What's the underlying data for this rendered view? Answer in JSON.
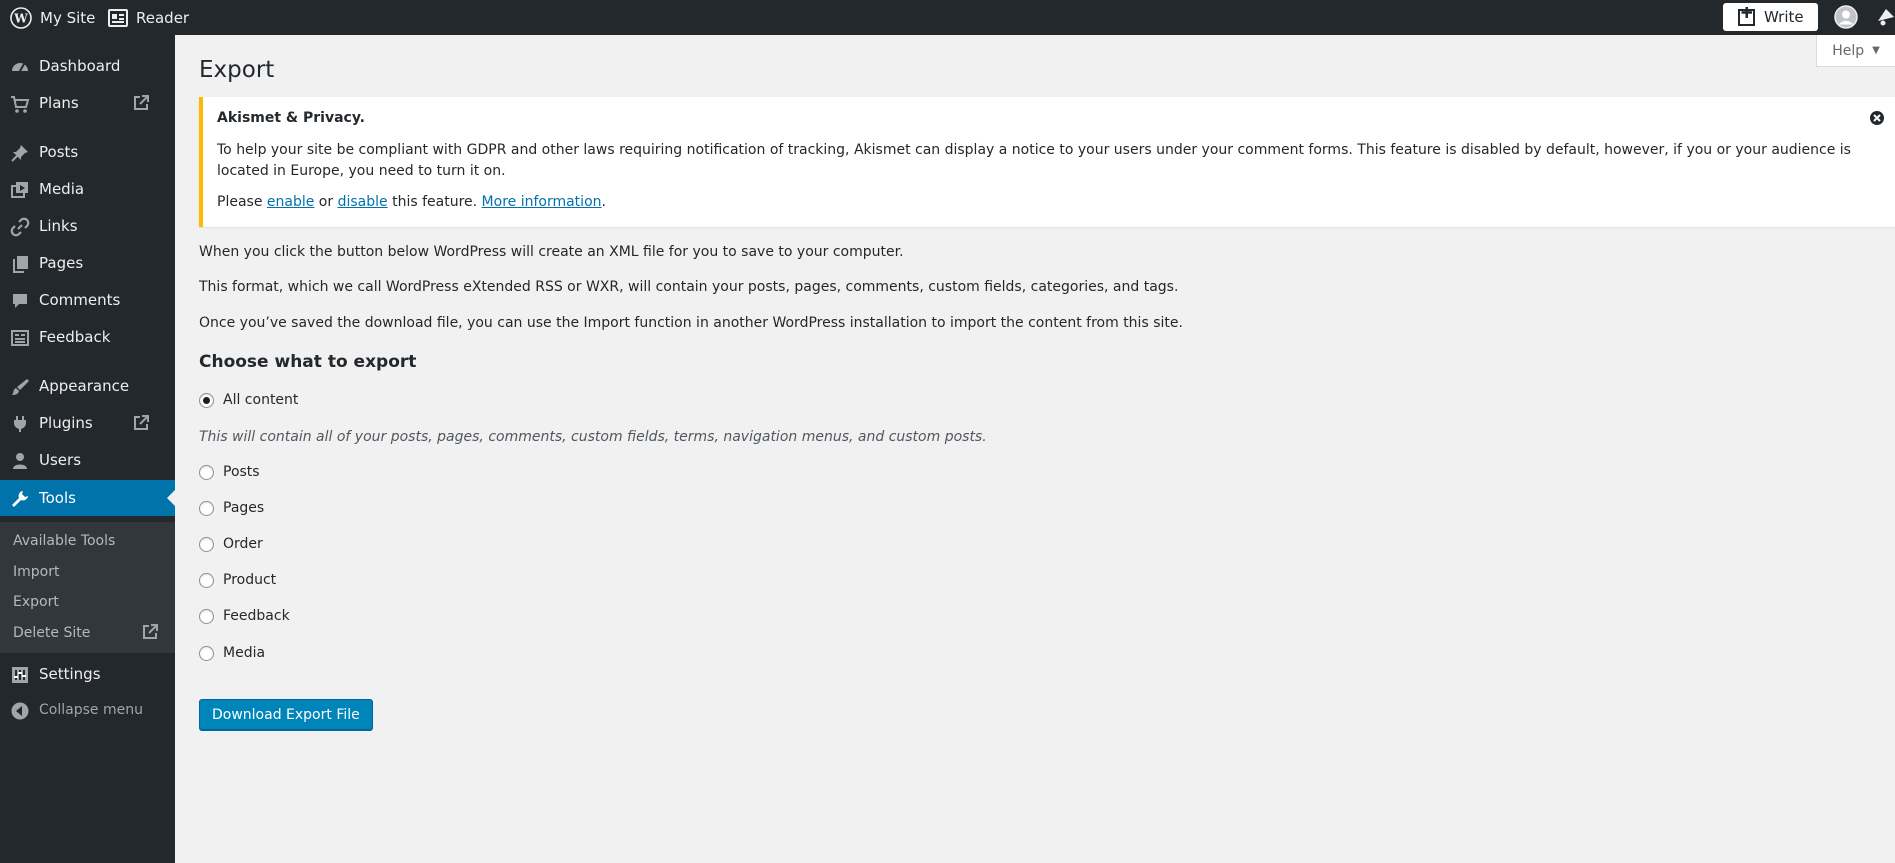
{
  "topbar": {
    "my_site": "My Site",
    "reader": "Reader",
    "write": "Write"
  },
  "sidebar": {
    "items": [
      {
        "label": "Dashboard",
        "icon": "dashboard-icon"
      },
      {
        "label": "Plans",
        "icon": "cart-icon",
        "external": true
      },
      {
        "label": "Posts",
        "icon": "pin-icon"
      },
      {
        "label": "Media",
        "icon": "media-icon"
      },
      {
        "label": "Links",
        "icon": "link-icon"
      },
      {
        "label": "Pages",
        "icon": "pages-icon"
      },
      {
        "label": "Comments",
        "icon": "comment-icon"
      },
      {
        "label": "Feedback",
        "icon": "feedback-icon"
      },
      {
        "label": "Appearance",
        "icon": "brush-icon"
      },
      {
        "label": "Plugins",
        "icon": "plugin-icon",
        "external": true
      },
      {
        "label": "Users",
        "icon": "user-icon"
      },
      {
        "label": "Tools",
        "icon": "wrench-icon",
        "active": true
      },
      {
        "label": "Settings",
        "icon": "settings-icon"
      }
    ],
    "submenu": [
      {
        "label": "Available Tools"
      },
      {
        "label": "Import"
      },
      {
        "label": "Export"
      },
      {
        "label": "Delete Site",
        "external": true
      }
    ],
    "collapse": "Collapse menu"
  },
  "help": "Help",
  "page_title": "Export",
  "notice": {
    "title": "Akismet & Privacy.",
    "body": "To help your site be compliant with GDPR and other laws requiring notification of tracking, Akismet can display a notice to your users under your comment forms. This feature is disabled by default, however, if you or your audience is located in Europe, you need to turn it on.",
    "please": "Please ",
    "enable": "enable",
    "or": " or ",
    "disable": "disable",
    "this_feature": " this feature. ",
    "more_info": "More information",
    "period": "."
  },
  "intro": [
    "When you click the button below WordPress will create an XML file for you to save to your computer.",
    "This format, which we call WordPress eXtended RSS or WXR, will contain your posts, pages, comments, custom fields, categories, and tags.",
    "Once you’ve saved the download file, you can use the Import function in another WordPress installation to import the content from this site."
  ],
  "choose_heading": "Choose what to export",
  "options": [
    {
      "label": "All content",
      "checked": true
    },
    {
      "label": "Posts",
      "checked": false
    },
    {
      "label": "Pages",
      "checked": false
    },
    {
      "label": "Order",
      "checked": false
    },
    {
      "label": "Product",
      "checked": false
    },
    {
      "label": "Feedback",
      "checked": false
    },
    {
      "label": "Media",
      "checked": false
    }
  ],
  "all_content_desc": "This will contain all of your posts, pages, comments, custom fields, terms, navigation menus, and custom posts.",
  "download_button": "Download Export File",
  "colors": {
    "admin_bar": "#23282d",
    "active": "#0073aa",
    "notice_border": "#ffb900",
    "button": "#0085ba"
  }
}
